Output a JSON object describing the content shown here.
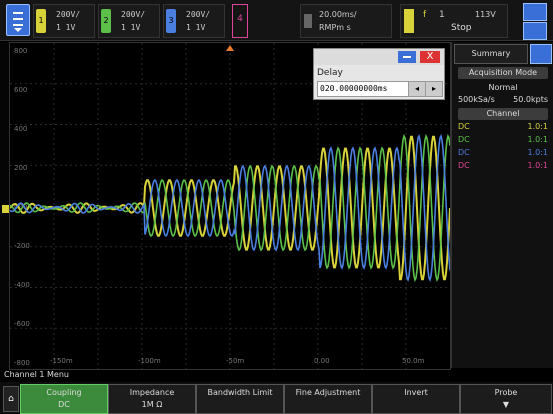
{
  "topbar": {
    "channels": [
      {
        "num": "1",
        "scale": "200V/",
        "coupling": "1 1V",
        "color": "#d7d23a"
      },
      {
        "num": "2",
        "scale": "200V/",
        "coupling": "1 1V",
        "color": "#5bbf4a"
      },
      {
        "num": "3",
        "scale": "200V/",
        "coupling": "1 1V",
        "color": "#4a7fe0"
      }
    ],
    "ch4_label": "4",
    "timebase": {
      "line1": "20.00ms/",
      "line2": "RMPm s"
    },
    "trigger": {
      "glyph": "f",
      "source": "1",
      "level": "113V",
      "status": "Stop"
    }
  },
  "graticule_labels": {
    "left": [
      "800",
      "600",
      "400",
      "200",
      "000",
      "-200",
      "-400",
      "-600",
      "-800"
    ],
    "bottom": [
      "-150m",
      "-100m",
      "-50m",
      "0.00",
      "50.0m"
    ]
  },
  "delay_dialog": {
    "title": "Delay",
    "value": "020.00000000ms",
    "left": "◂",
    "right": "▸",
    "close": "X"
  },
  "summary": {
    "tab": "Summary",
    "acq_header": "Acquisition Mode",
    "acq_mode": "Normal",
    "sample_rate": "500kSa/s",
    "points": "50.0kpts",
    "channel_header": "Channel",
    "channels": [
      {
        "coupling": "DC",
        "value": "1.0:1",
        "color": "#d7d23a"
      },
      {
        "coupling": "DC",
        "value": "1.0:1",
        "color": "#5bbf4a"
      },
      {
        "coupling": "DC",
        "value": "1.0:1",
        "color": "#4a7fe0"
      },
      {
        "coupling": "DC",
        "value": "1.0:1",
        "color": "#e0449a"
      }
    ]
  },
  "menu_title": "Channel 1 Menu",
  "softkeys": [
    {
      "title": "Coupling",
      "value": "DC"
    },
    {
      "title": "Impedance",
      "value": "1M Ω"
    },
    {
      "title": "Bandwidth Limit",
      "value": ""
    },
    {
      "title": "Fine Adjustment",
      "value": ""
    },
    {
      "title": "Invert",
      "value": ""
    },
    {
      "title": "Probe",
      "value": "▼"
    }
  ],
  "colors": {
    "ch1": "#d7d23a",
    "ch2": "#5bbf4a",
    "ch3": "#4a7fe0",
    "ch4": "#e0449a"
  },
  "icons": [
    "menu-icon",
    "pause-icon",
    "lock-icon",
    "home-icon",
    "minimize-icon",
    "close-icon"
  ]
}
